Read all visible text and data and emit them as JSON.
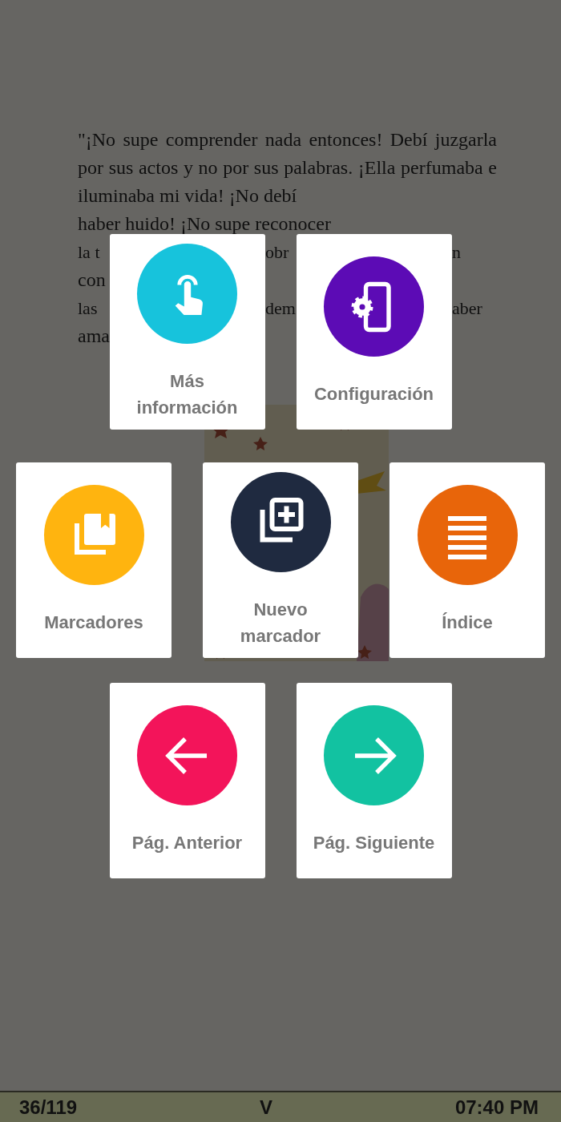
{
  "book_page": {
    "lines": [
      {
        "segments": [
          "\"¡No supe comprender nada entonces! Debí juzgarla por sus actos y no por sus palabras. ¡Ella perfumaba e iluminaba mi vida! ¡No debí"
        ]
      },
      {
        "segments": [
          "haber huido! ¡No supe reconocer"
        ]
      },
      {
        "segments": [
          "la t",
          "obr",
          "n"
        ]
      },
      {
        "segments": [
          "con"
        ]
      },
      {
        "segments": [
          "las",
          "dem",
          "aber"
        ]
      },
      {
        "segments": [
          "ama"
        ]
      }
    ]
  },
  "menu": {
    "rows": [
      [
        {
          "label": "Más información",
          "kind": "touch",
          "color": "#17c3dc"
        },
        {
          "label": "Configuración",
          "kind": "settings-phone",
          "color": "#5c0bb5"
        }
      ],
      [
        {
          "label": "Marcadores",
          "kind": "bookmarks",
          "color": "#ffb40f"
        },
        {
          "label": "Nuevo marcador",
          "kind": "add-bookmark",
          "color": "#1f2a40"
        },
        {
          "label": "Índice",
          "kind": "list",
          "color": "#e8650a"
        }
      ],
      [
        {
          "label": "Pág. Anterior",
          "kind": "arrow-left",
          "color": "#f3145a"
        },
        {
          "label": "Pág. Siguiente",
          "kind": "arrow-right",
          "color": "#12c2a1"
        }
      ]
    ]
  },
  "status_bar": {
    "page": "36/119",
    "chapter": "V",
    "time": "07:40 PM"
  }
}
